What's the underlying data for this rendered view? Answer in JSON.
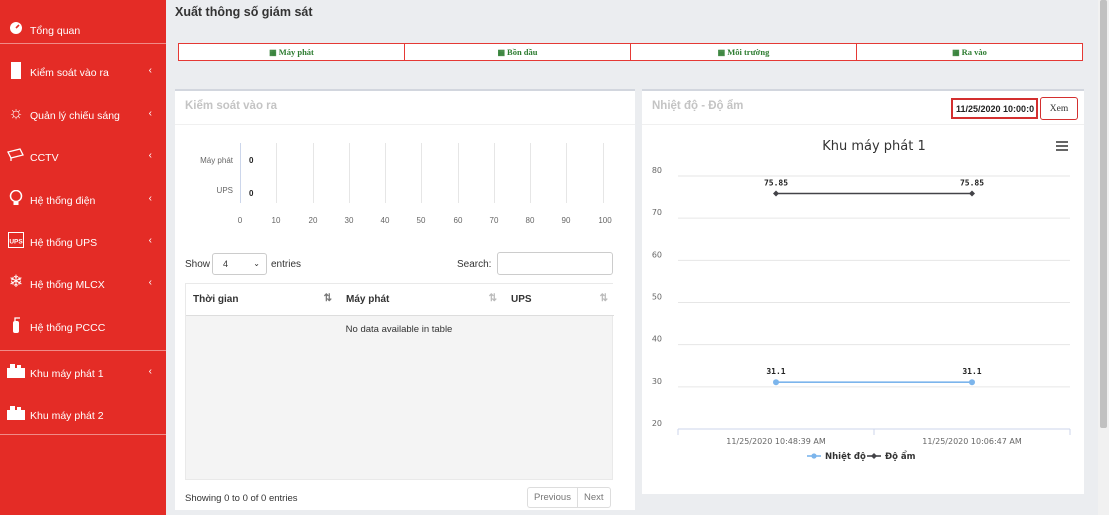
{
  "sidebar": {
    "items": [
      {
        "label": "Tổng quan",
        "icon": "dashboard-icon",
        "arrow": ""
      },
      {
        "label": "Kiểm soát vào ra",
        "icon": "door-icon",
        "arrow": "‹"
      },
      {
        "label": "Quản lý chiếu sáng",
        "icon": "sun-icon",
        "arrow": "‹"
      },
      {
        "label": "CCTV",
        "icon": "camera-icon",
        "arrow": "‹"
      },
      {
        "label": "Hệ thống điện",
        "icon": "bulb-icon",
        "arrow": "‹"
      },
      {
        "label": "Hệ thống UPS",
        "icon": "ups-icon",
        "arrow": "‹"
      },
      {
        "label": "Hệ thống MLCX",
        "icon": "snowflake-icon",
        "arrow": "‹"
      },
      {
        "label": "Hệ thống PCCC",
        "icon": "fire-extinguisher-icon",
        "arrow": ""
      },
      {
        "label": "Khu máy phát 1",
        "icon": "generator-icon",
        "arrow": "‹"
      },
      {
        "label": "Khu máy phát 2",
        "icon": "generator-icon",
        "arrow": ""
      }
    ]
  },
  "page": {
    "title": "Xuất thông số giám sát"
  },
  "tabs": [
    "Máy phát",
    "Bồn dầu",
    "Môi trường",
    "Ra vào"
  ],
  "access_panel": {
    "title": "Kiểm soát vào ra",
    "chart": {
      "labels": [
        "Máy phát",
        "UPS"
      ],
      "values": [
        "0",
        "0"
      ],
      "ticks": [
        "0",
        "10",
        "20",
        "30",
        "40",
        "50",
        "60",
        "70",
        "80",
        "90",
        "100"
      ]
    },
    "show_label": "Show",
    "entries_value": "4",
    "entries_label": "entries",
    "search_label": "Search:",
    "columns": [
      "Thời gian",
      "Máy phát",
      "UPS"
    ],
    "empty_text": "No data available in table",
    "info": "Showing 0 to 0 of 0 entries",
    "prev": "Previous",
    "next": "Next"
  },
  "env_panel": {
    "title": "Nhiệt độ - Độ ẩm",
    "date_value": "11/25/2020 10:00:0",
    "view_button": "Xem",
    "menu_icon": "hamburger-icon"
  },
  "colors": {
    "sidebar": "#e42c26",
    "temp": "#7cb5ec",
    "humidity": "#434348",
    "tab_text": "#2e7d32"
  },
  "chart_data": {
    "type": "line",
    "title": "Khu máy phát 1",
    "categories": [
      "11/25/2020 10:48:39 AM",
      "11/25/2020 10:06:47 AM"
    ],
    "series": [
      {
        "name": "Nhiệt độ",
        "values": [
          31.1,
          31.1
        ]
      },
      {
        "name": "Độ ẩm",
        "values": [
          75.85,
          75.85
        ]
      }
    ],
    "yticks": [
      "80",
      "70",
      "60",
      "50",
      "40",
      "30",
      "20"
    ],
    "ylim": [
      20,
      80
    ],
    "grid": true,
    "legend": "bottom"
  }
}
